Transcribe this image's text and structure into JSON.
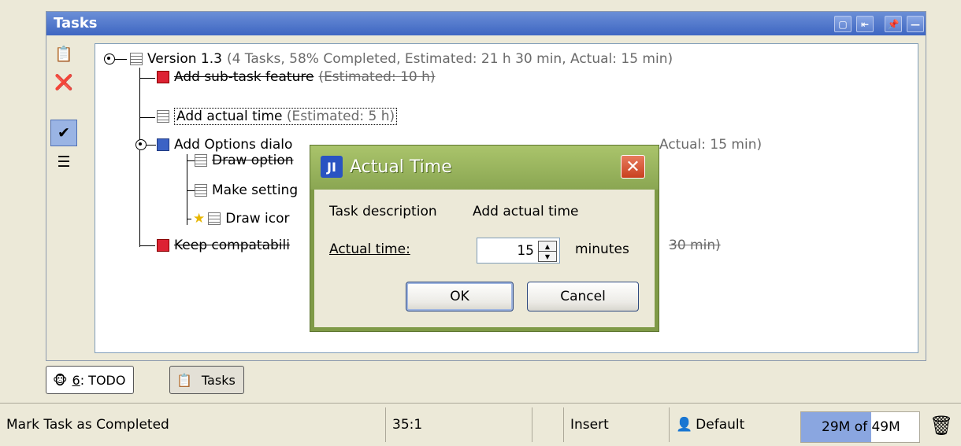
{
  "tasks_window": {
    "title": "Tasks",
    "title_buttons": [
      "window-icon",
      "move-icon",
      "pin-icon",
      "minimize-icon"
    ]
  },
  "tree": {
    "root": {
      "label": "Version 1.3",
      "summary": "(4 Tasks, 58% Completed, Estimated: 21 h 30 min, Actual: 15 min)"
    },
    "item1": {
      "label": "Add sub-task feature",
      "estimate": "(Estimated: 10 h)"
    },
    "item2": {
      "label": "Add actual time",
      "estimate": "(Estimated: 5 h)"
    },
    "item3": {
      "label": "Add Options dialo",
      "summary_tail": "Actual: 15 min)"
    },
    "child1": {
      "label": "Draw option"
    },
    "child2": {
      "label": "Make setting"
    },
    "child3": {
      "label": "Draw icor"
    },
    "item4": {
      "label": "Keep compatabili",
      "tail": "30 min)"
    }
  },
  "dialog": {
    "title": "Actual Time",
    "task_description_label": "Task description",
    "task_description_value": "Add actual time",
    "actual_time_label": "Actual time:",
    "actual_time_value": "15",
    "unit": "minutes",
    "ok": "OK",
    "cancel": "Cancel"
  },
  "tool_tabs": {
    "todo_num": "6",
    "todo_rest": ": TODO",
    "tasks": "Tasks"
  },
  "status": {
    "message": "Mark Task as Completed",
    "position": "35:1",
    "mode": "Insert",
    "scheme": "Default",
    "memory": "29M of 49M",
    "memory_fraction": 0.59
  }
}
